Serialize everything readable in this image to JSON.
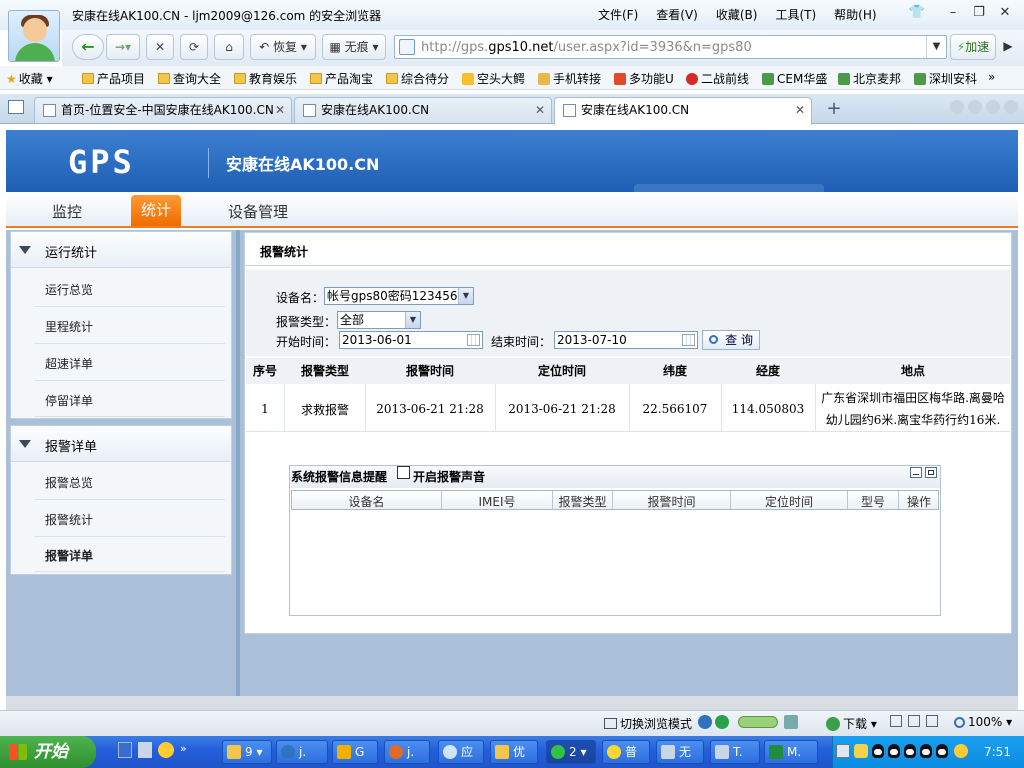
{
  "window": {
    "title": "安康在线AK100.CN - ljm2009@126.com 的安全浏览器",
    "menus": [
      "文件(F)",
      "查看(V)",
      "收藏(B)",
      "工具(T)",
      "帮助(H)"
    ]
  },
  "toolbar": {
    "restore_label": "恢复",
    "no_trace_label": "无痕",
    "accelerate_label": "加速"
  },
  "address": {
    "prefix": "http://gps.",
    "domain": "gps10.net",
    "suffix": "/user.aspx?id=3936&n=gps80"
  },
  "favorites": {
    "label": "收藏",
    "items": [
      "产品项目",
      "查询大全",
      "教育娱乐",
      "产品淘宝",
      "综合待分",
      "空头大鳄",
      "手机转接",
      "多功能U",
      "二战前线",
      "CEM华盛",
      "北京麦邦",
      "深圳安科"
    ],
    "more": "»"
  },
  "tabs": [
    {
      "label": "首页-位置安全-中国安康在线AK100.CN"
    },
    {
      "label": "安康在线AK100.CN"
    },
    {
      "label": "安康在线AK100.CN"
    }
  ],
  "site": {
    "logo": "GPS",
    "title": "安康在线AK100.CN"
  },
  "nav": [
    "监控",
    "统计",
    "设备管理"
  ],
  "sidebar": {
    "group1": {
      "title": "运行统计",
      "items": [
        "运行总览",
        "里程统计",
        "超速详单",
        "停留详单"
      ]
    },
    "group2": {
      "title": "报警详单",
      "items": [
        "报警总览",
        "报警统计",
        "报警详单"
      ]
    }
  },
  "main": {
    "title": "报警统计",
    "device_label": "设备名：",
    "device_value": "帐号gps80密码123456",
    "type_label": "报警类型：",
    "type_value": "全部",
    "start_label": "开始时间：",
    "start_value": "2013-06-01",
    "end_label": "结束时间：",
    "end_value": "2013-07-10",
    "query_label": "查 询"
  },
  "table": {
    "headers": [
      "序号",
      "报警类型",
      "报警时间",
      "定位时间",
      "纬度",
      "经度",
      "地点"
    ],
    "row": {
      "index": "1",
      "type": "求救报警",
      "alarm_time": "2013-06-21 21:28",
      "locate_time": "2013-06-21 21:28",
      "lat": "22.566107",
      "lng": "114.050803",
      "place_line1": "广东省深圳市福田区梅华路.离曼哈",
      "place_line2": "幼儿园约6米.离宝华药行约16米."
    }
  },
  "alarm_panel": {
    "title": "系统报警信息提醒",
    "sound_label": "开启报警声音",
    "columns": [
      "设备名",
      "IMEI号",
      "报警类型",
      "报警时间",
      "定位时间",
      "型号",
      "操作"
    ]
  },
  "statusbar": {
    "switch_mode": "切换浏览模式",
    "download": "下载",
    "zoom": "100%"
  },
  "taskbar": {
    "start": "开始",
    "items": [
      "9",
      "j.",
      "G",
      "j.",
      "应",
      "优",
      "2",
      "普",
      "无",
      "T.",
      "M."
    ],
    "clock": "7:51"
  },
  "colors": {
    "banner": "#2a6bc2",
    "accent_tab": "#f27b1f",
    "taskbar": "#245edb"
  }
}
